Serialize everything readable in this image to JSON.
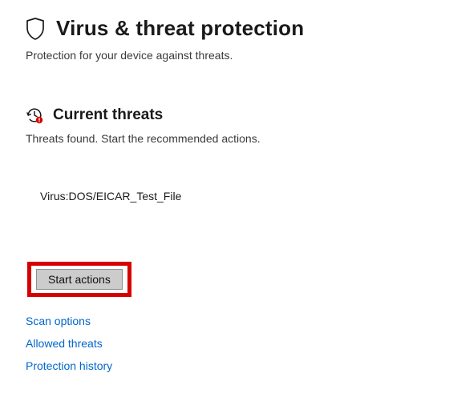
{
  "header": {
    "title": "Virus & threat protection",
    "subtitle": "Protection for your device against threats."
  },
  "current_threats": {
    "title": "Current threats",
    "subtitle": "Threats found. Start the recommended actions.",
    "items": [
      {
        "name": "Virus:DOS/EICAR_Test_File"
      }
    ]
  },
  "actions": {
    "start_button_label": "Start actions"
  },
  "links": {
    "scan_options": "Scan options",
    "allowed_threats": "Allowed threats",
    "protection_history": "Protection history"
  }
}
